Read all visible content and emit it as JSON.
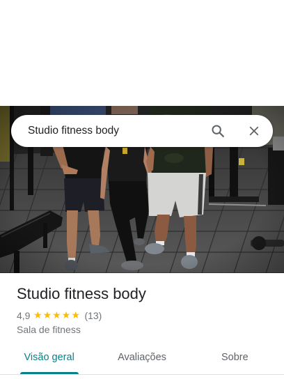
{
  "search_bar": {
    "query": "Studio fitness body",
    "search_icon": "search-icon",
    "close_icon": "close-icon"
  },
  "place": {
    "name": "Studio fitness body",
    "rating": "4,9",
    "stars_filled": 5,
    "stars_total": 5,
    "review_count": "(13)",
    "category": "Sala de fitness",
    "star_icon": "star-icon"
  },
  "tabs": [
    {
      "label": "Visão geral",
      "active": true
    },
    {
      "label": "Avaliações",
      "active": false
    },
    {
      "label": "Sobre",
      "active": false
    }
  ],
  "colors": {
    "accent": "#0b7f86",
    "star": "#fbbc04",
    "text_primary": "#202124",
    "text_secondary": "#70757a"
  }
}
